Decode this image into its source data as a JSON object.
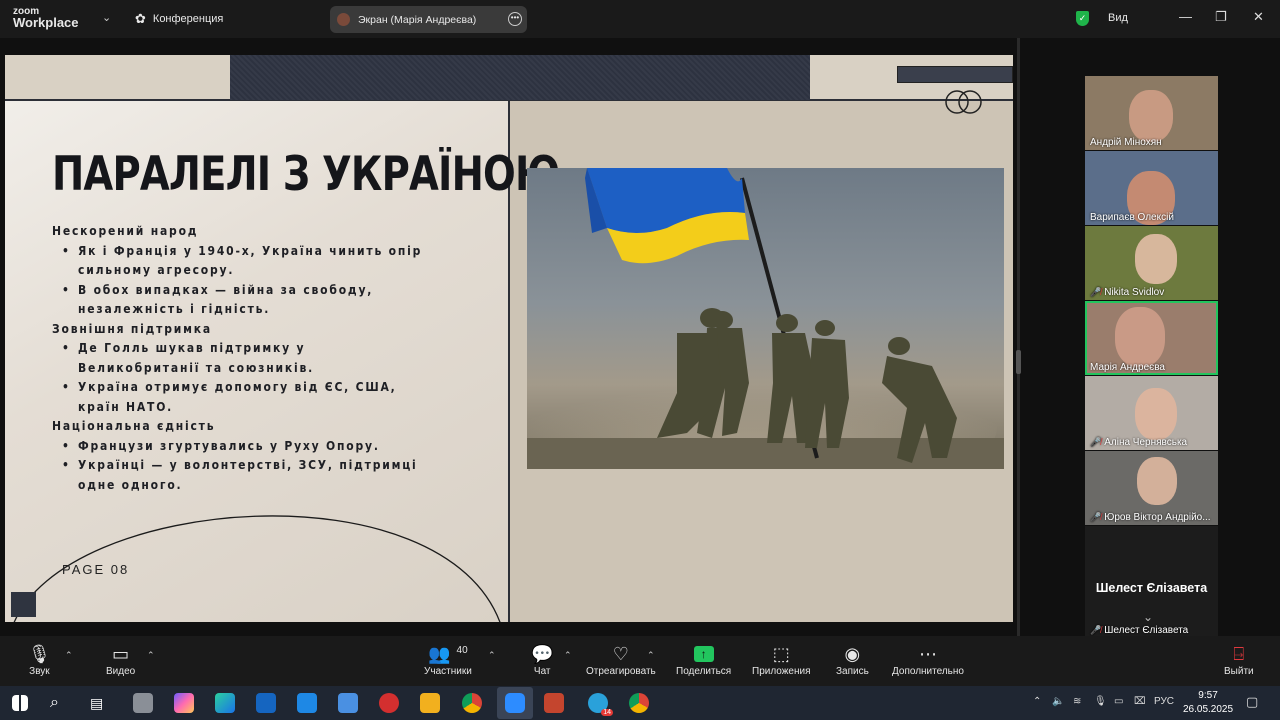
{
  "app": {
    "logo_line1": "zoom",
    "logo_line2": "Workplace",
    "meeting_label": "Конференция",
    "screen_share_label": "Экран (Марія Андреєва)",
    "view_label": "Вид",
    "secure_color": "#1fb44a"
  },
  "slide": {
    "title": "ПАРАЛЕЛІ З УКРАЇНОЮ",
    "sections": [
      {
        "heading": "Нескорений народ",
        "bullets": [
          [
            "Як і Франція у 1940-х, Україна чинить опір",
            "сильному агресору."
          ],
          [
            "В обох випадках — війна за свободу,",
            "незалежність і гідність."
          ]
        ]
      },
      {
        "heading": "Зовнішня підтримка",
        "bullets": [
          [
            "Де Голль шукав підтримку у",
            "Великобританії та союзників."
          ],
          [
            "Україна отримує допомогу від ЄС, США,",
            "країн НАТО."
          ]
        ]
      },
      {
        "heading": "Національна єдність",
        "bullets": [
          [
            "Французи згуртувались у Руху Опору."
          ],
          [
            "Українці — у волонтерстві, ЗСУ, підтримці",
            "одне одного."
          ]
        ]
      }
    ],
    "page_label": "PAGE 08",
    "photo_icon": "soldiers-raising-ukrainian-flag-photo"
  },
  "participants": [
    {
      "name": "Андрій Мінохян",
      "muted": false,
      "active": false,
      "bg": "#8c7a64",
      "face": "#c89a82"
    },
    {
      "name": "Варипаєв Олексій",
      "muted": false,
      "active": false,
      "bg": "#5b6e8a",
      "face": "#c48a72"
    },
    {
      "name": "Nikita Svidlov",
      "muted": true,
      "active": false,
      "bg": "#6d7a3e",
      "face": "#d7b79c"
    },
    {
      "name": "Марія Андреєва",
      "muted": false,
      "active": true,
      "bg": "#9a7d6c",
      "face": "#c99a86"
    },
    {
      "name": "Аліна Чернявська",
      "muted": true,
      "active": false,
      "bg": "#b3aca5",
      "face": "#dbb49e"
    },
    {
      "name": "Юров Віктор Андрійо...",
      "muted": true,
      "active": false,
      "bg": "#6b6a67",
      "face": "#d3b09a"
    }
  ],
  "avatar_tile": {
    "big_name": "Шелест Єлізавета",
    "name": "Шелест Єлізавета",
    "muted": true
  },
  "toolbar": {
    "audio": "Звук",
    "video": "Видео",
    "participants": "Участники",
    "participants_count": "40",
    "chat": "Чат",
    "react": "Отреагировать",
    "share": "Поделиться",
    "apps": "Приложения",
    "record": "Запись",
    "more": "Дополнительно",
    "leave": "Выйти"
  },
  "taskbar": {
    "lang": "РУС",
    "time": "9:57",
    "date": "26.05.2025",
    "telegram_badge": "14"
  }
}
